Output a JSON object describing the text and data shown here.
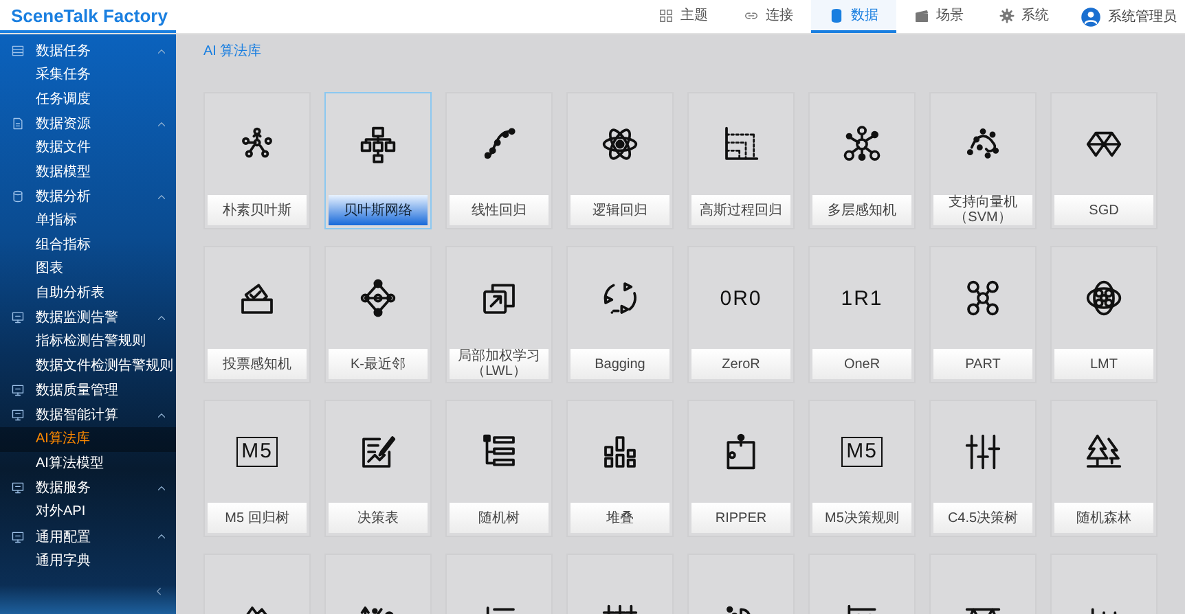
{
  "header": {
    "logo": "SceneTalk Factory",
    "nav": [
      {
        "label": "主题",
        "selected": false
      },
      {
        "label": "连接",
        "selected": false
      },
      {
        "label": "数据",
        "selected": true
      },
      {
        "label": "场景",
        "selected": false
      },
      {
        "label": "系统",
        "selected": false
      }
    ],
    "user": "系统管理员"
  },
  "sidebar": {
    "groups": [
      {
        "label": "数据任务",
        "expanded": true,
        "children": [
          {
            "label": "采集任务",
            "selected": false
          },
          {
            "label": "任务调度",
            "selected": false
          }
        ]
      },
      {
        "label": "数据资源",
        "expanded": true,
        "children": [
          {
            "label": "数据文件",
            "selected": false
          },
          {
            "label": "数据模型",
            "selected": false
          }
        ]
      },
      {
        "label": "数据分析",
        "expanded": true,
        "children": [
          {
            "label": "单指标",
            "selected": false
          },
          {
            "label": "组合指标",
            "selected": false
          },
          {
            "label": "图表",
            "selected": false
          },
          {
            "label": "自助分析表",
            "selected": false
          }
        ]
      },
      {
        "label": "数据监测告警",
        "expanded": true,
        "children": [
          {
            "label": "指标检测告警规则",
            "selected": false
          },
          {
            "label": "数据文件检测告警规则",
            "selected": false
          }
        ]
      },
      {
        "label": "数据质量管理",
        "expanded": false
      },
      {
        "label": "数据智能计算",
        "expanded": true,
        "children": [
          {
            "label": "AI算法库",
            "selected": true
          },
          {
            "label": "AI算法模型",
            "selected": false
          }
        ]
      },
      {
        "label": "数据服务",
        "expanded": true,
        "children": [
          {
            "label": "对外API",
            "selected": false
          }
        ]
      },
      {
        "label": "通用配置",
        "expanded": true,
        "children": [
          {
            "label": "通用字典",
            "selected": false
          }
        ]
      }
    ]
  },
  "page": {
    "title": "AI 算法库",
    "cards": [
      {
        "label": "朴素贝叶斯",
        "selected": false
      },
      {
        "label": "贝叶斯网络",
        "selected": true
      },
      {
        "label": "线性回归",
        "selected": false
      },
      {
        "label": "逻辑回归",
        "selected": false
      },
      {
        "label": "高斯过程回归",
        "selected": false
      },
      {
        "label": "多层感知机",
        "selected": false
      },
      {
        "label": "支持向量机（SVM）",
        "selected": false
      },
      {
        "label": "SGD",
        "selected": false
      },
      {
        "label": "投票感知机",
        "selected": false
      },
      {
        "label": "K-最近邻",
        "selected": false
      },
      {
        "label": "局部加权学习（LWL）",
        "selected": false
      },
      {
        "label": "Bagging",
        "selected": false
      },
      {
        "label": "ZeroR",
        "icon_text": "0R0",
        "selected": false
      },
      {
        "label": "OneR",
        "icon_text": "1R1",
        "selected": false
      },
      {
        "label": "PART",
        "selected": false
      },
      {
        "label": "LMT",
        "selected": false
      },
      {
        "label": "M5 回归树",
        "icon_text": "M5",
        "selected": false
      },
      {
        "label": "决策表",
        "selected": false
      },
      {
        "label": "随机树",
        "selected": false
      },
      {
        "label": "堆叠",
        "selected": false
      },
      {
        "label": "RIPPER",
        "selected": false
      },
      {
        "label": "M5决策规则",
        "icon_text": "M5",
        "selected": false
      },
      {
        "label": "C4.5决策树",
        "selected": false
      },
      {
        "label": "随机森林",
        "selected": false
      },
      {
        "selected": false
      },
      {
        "selected": false
      },
      {
        "selected": false
      },
      {
        "selected": false
      },
      {
        "selected": false
      },
      {
        "selected": false
      },
      {
        "selected": false
      },
      {
        "selected": false
      }
    ]
  }
}
